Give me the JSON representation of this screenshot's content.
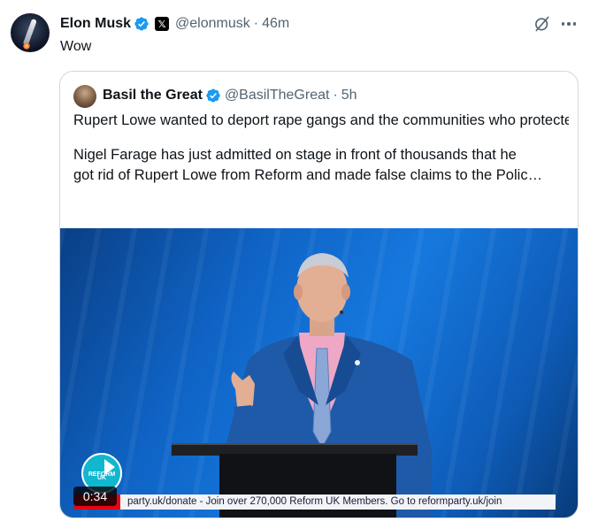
{
  "post": {
    "author_name": "Elon Musk",
    "handle": "@elonmusk",
    "separator": "·",
    "time": "46m",
    "text": "Wow",
    "icons": {
      "verified": "verified-badge-icon",
      "affiliate": "x-logo-icon",
      "grok": "grok-icon",
      "more": "more-options-icon"
    }
  },
  "quoted": {
    "author_name": "Basil the Great",
    "handle": "@BasilTheGreat",
    "separator": "·",
    "time": "5h",
    "paragraph_1": "Rupert Lowe wanted to deport rape gangs and the communities who protected them",
    "paragraph_2_line_1": "Nigel Farage has just admitted on stage in front of thousands that he",
    "paragraph_2_line_2": "got rid of Rupert Lowe from Reform and made false claims to the Polic…",
    "video": {
      "duration": "0:34",
      "logo_text_1": "REFORM",
      "logo_text_2": "UK",
      "ticker": "party.uk/donate   -   Join over 270,000 Reform UK Members. Go to reformparty.uk/join"
    }
  },
  "colors": {
    "verified_blue": "#1d9bf0",
    "secondary_text": "#536471",
    "border": "#cfd9de",
    "reform_teal": "#12b6cf"
  }
}
